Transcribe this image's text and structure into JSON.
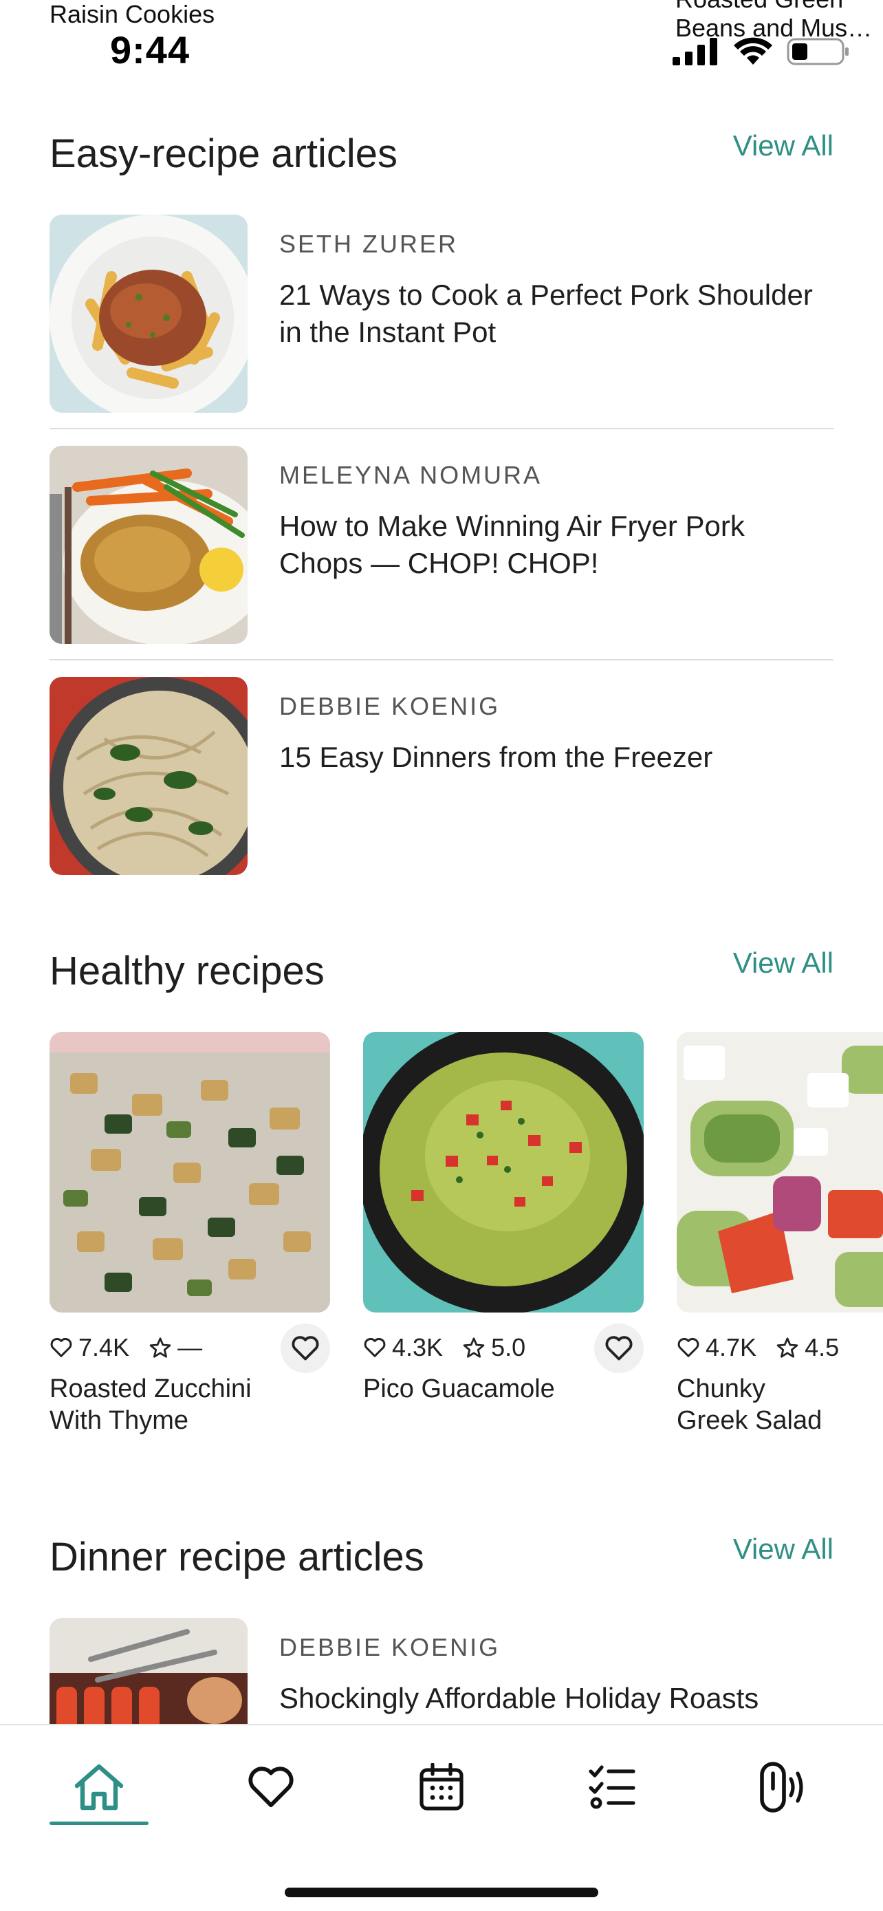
{
  "status_bar": {
    "left_title": "Raisin Cookies",
    "time": "9:44",
    "right_title_line1": "Roasted Green",
    "right_title_line2": "Beans and Mush…"
  },
  "sections": {
    "easy": {
      "title": "Easy-recipe articles",
      "view_all": "View All"
    },
    "healthy": {
      "title": "Healthy recipes",
      "view_all": "View All"
    },
    "dinner": {
      "title": "Dinner recipe articles",
      "view_all": "View All"
    }
  },
  "easy_articles": [
    {
      "author": "Seth Zurer",
      "title": "21 Ways to Cook a Perfect Pork Shoulder in the Instant Pot"
    },
    {
      "author": "Meleyna Nomura",
      "title": "How to Make Winning Air Fryer Pork Chops —  CHOP! CHOP!"
    },
    {
      "author": "Debbie Koenig",
      "title": "15 Easy Dinners from the Freezer"
    }
  ],
  "healthy_recipes": [
    {
      "likes": "7.4K",
      "rating": "—",
      "name": "Roasted Zucchini With Thyme"
    },
    {
      "likes": "4.3K",
      "rating": "5.0",
      "name": "Pico Guacamole"
    },
    {
      "likes": "4.7K",
      "rating": "4.5",
      "name": "Chunky Greek Salad"
    }
  ],
  "dinner_articles": [
    {
      "author": "Debbie Koenig",
      "title": "Shockingly Affordable Holiday Roasts"
    }
  ],
  "colors": {
    "accent": "#2e8f86",
    "text": "#1f1f1f",
    "muted": "#555555"
  }
}
